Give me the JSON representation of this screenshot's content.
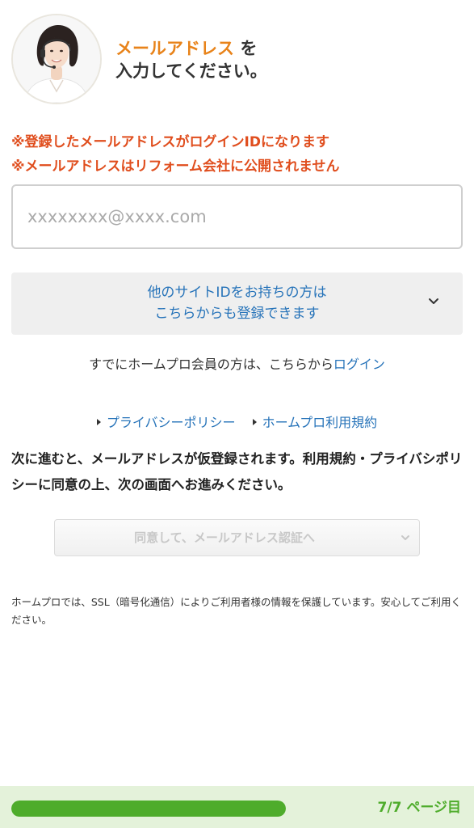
{
  "header": {
    "heading_accent": "メールアドレス",
    "heading_rest1": "を",
    "heading_line2": "入力してください。"
  },
  "warnings": [
    "※登録したメールアドレスがログインIDになります",
    "※メールアドレスはリフォーム会社に公開されません"
  ],
  "email": {
    "value": "",
    "placeholder": "xxxxxxxx@xxxx.com"
  },
  "other_id": {
    "line1": "他のサイトIDをお持ちの方は",
    "line2": "こちらからも登録できます",
    "icon": "chevron-down-icon"
  },
  "login": {
    "prefix": "すでにホームプロ会員の方は、こちらから",
    "link": "ログイン"
  },
  "links": {
    "privacy": "プライバシーポリシー",
    "terms": "ホームプロ利用規約"
  },
  "notice": "次に進むと、メールアドレスが仮登録されます。利用規約・プライバシポリシーに同意の上、次の画面へお進みください。",
  "submit": {
    "label": "同意して、メールアドレス認証へ",
    "icon": "chevron-down-icon"
  },
  "ssl_note": "ホームプロでは、SSL（暗号化通信）によりご利用者様の情報を保護しています。安心してご利用ください。",
  "footer": {
    "progress": 1.0,
    "page_label": "7/7 ページ目"
  },
  "colors": {
    "accent_orange": "#e8831a",
    "warning_red": "#e04e1e",
    "link_blue": "#2673b9",
    "progress_green": "#4eac2b",
    "footer_bg": "#e4f2da"
  }
}
